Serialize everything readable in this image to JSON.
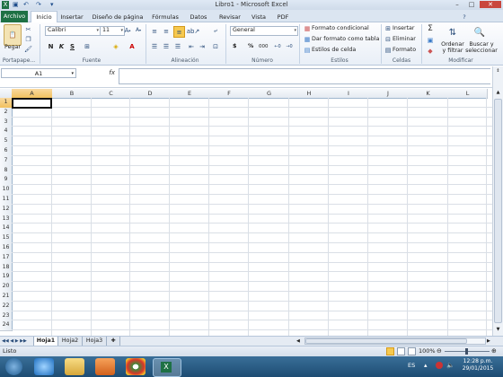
{
  "window": {
    "title": "Libro1  -  Microsoft Excel",
    "quick_access": [
      "save-icon",
      "undo-icon",
      "redo-icon"
    ],
    "controls": [
      "minimize-icon",
      "maximize-icon",
      "close-icon"
    ]
  },
  "tabs": [
    {
      "label": "Archivo",
      "kind": "file"
    },
    {
      "label": "Inicio",
      "kind": "active"
    },
    {
      "label": "Insertar"
    },
    {
      "label": "Diseño de página"
    },
    {
      "label": "Fórmulas"
    },
    {
      "label": "Datos"
    },
    {
      "label": "Revisar"
    },
    {
      "label": "Vista"
    },
    {
      "label": "PDF"
    }
  ],
  "ribbon": {
    "clipboard": {
      "paste_label": "Pegar",
      "group_label": "Portapape..."
    },
    "font": {
      "font_name": "Calibri",
      "font_size": "11",
      "bold": "N",
      "italic": "K",
      "underline": "S",
      "group_label": "Fuente"
    },
    "alignment": {
      "group_label": "Alineación"
    },
    "number": {
      "format": "General",
      "currency": "$",
      "percent": "%",
      "thousands": "000",
      "group_label": "Número"
    },
    "styles": {
      "conditional": "Formato condicional",
      "table": "Dar formato como tabla",
      "cell_styles": "Estilos de celda",
      "group_label": "Estilos"
    },
    "cells": {
      "insert": "Insertar",
      "delete": "Eliminar",
      "format": "Formato",
      "group_label": "Celdas"
    },
    "editing": {
      "sum": "Σ",
      "sort_line1": "Ordenar",
      "sort_line2": "y filtrar",
      "find_line1": "Buscar y",
      "find_line2": "seleccionar",
      "group_label": "Modificar"
    }
  },
  "formula_bar": {
    "name_box": "A1",
    "fx": "fx",
    "value": ""
  },
  "grid": {
    "columns": [
      "A",
      "B",
      "C",
      "D",
      "E",
      "F",
      "G",
      "H",
      "I",
      "J",
      "K",
      "L"
    ],
    "rows": [
      "1",
      "2",
      "3",
      "4",
      "5",
      "6",
      "7",
      "8",
      "9",
      "10",
      "11",
      "12",
      "13",
      "14",
      "15",
      "16",
      "17",
      "18",
      "19",
      "20",
      "21",
      "22",
      "23",
      "24"
    ],
    "selected_cell": "A1"
  },
  "sheets": [
    "Hoja1",
    "Hoja2",
    "Hoja3"
  ],
  "status": {
    "ready": "Listo",
    "zoom": "100%"
  },
  "taskbar": {
    "lang": "ES",
    "time": "12:28 p.m.",
    "date": "29/01/2015"
  }
}
